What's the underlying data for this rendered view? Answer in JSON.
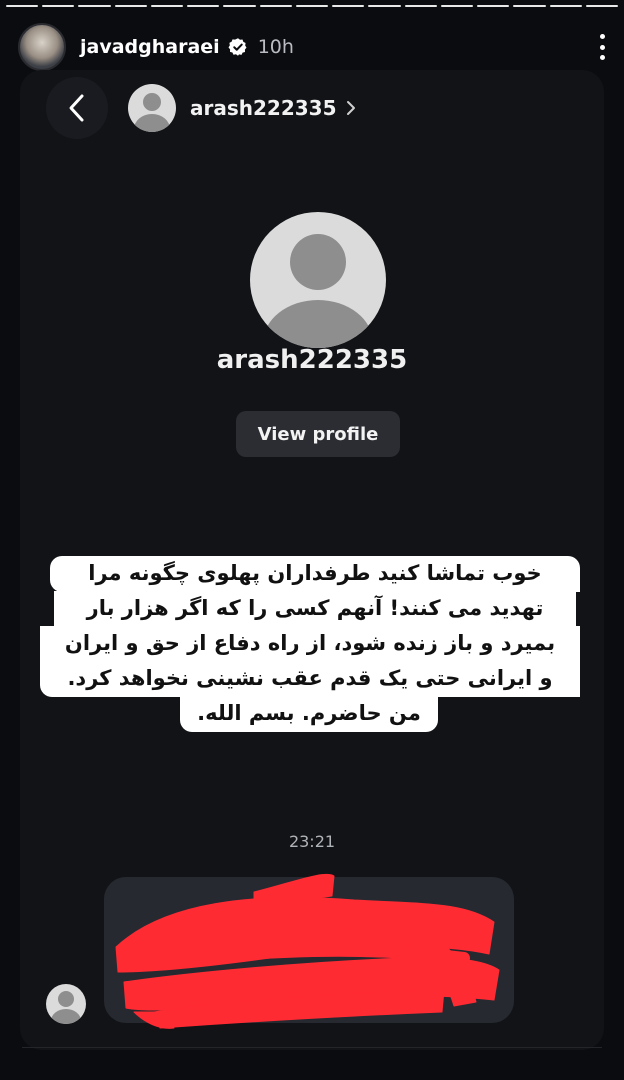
{
  "story": {
    "username": "javadgharaei",
    "time": "10h",
    "segments": 17
  },
  "dm": {
    "username": "arash222335",
    "view_profile_label": "View profile",
    "caption_lines": [
      "خوب تماشا کنید طرفداران پهلوی چگونه مرا",
      "تهدید می کنند! آنهم کسی را که اگر هزار بار",
      "بمیرد و باز زنده شود، از راه دفاع از حق و ایران",
      "و ایرانی حتی یک قدم عقب نشینی نخواهد کرد.",
      "من حاضرم. بسم الله."
    ],
    "timestamp": "23:21"
  },
  "colors": {
    "background": "#0b0c10",
    "bubble": "#262930",
    "redaction": "#ff2b33"
  },
  "icons": {
    "verified": "verified-badge-icon",
    "more": "more-vertical-icon",
    "back": "chevron-left-icon",
    "chevron": "chevron-right-icon"
  }
}
